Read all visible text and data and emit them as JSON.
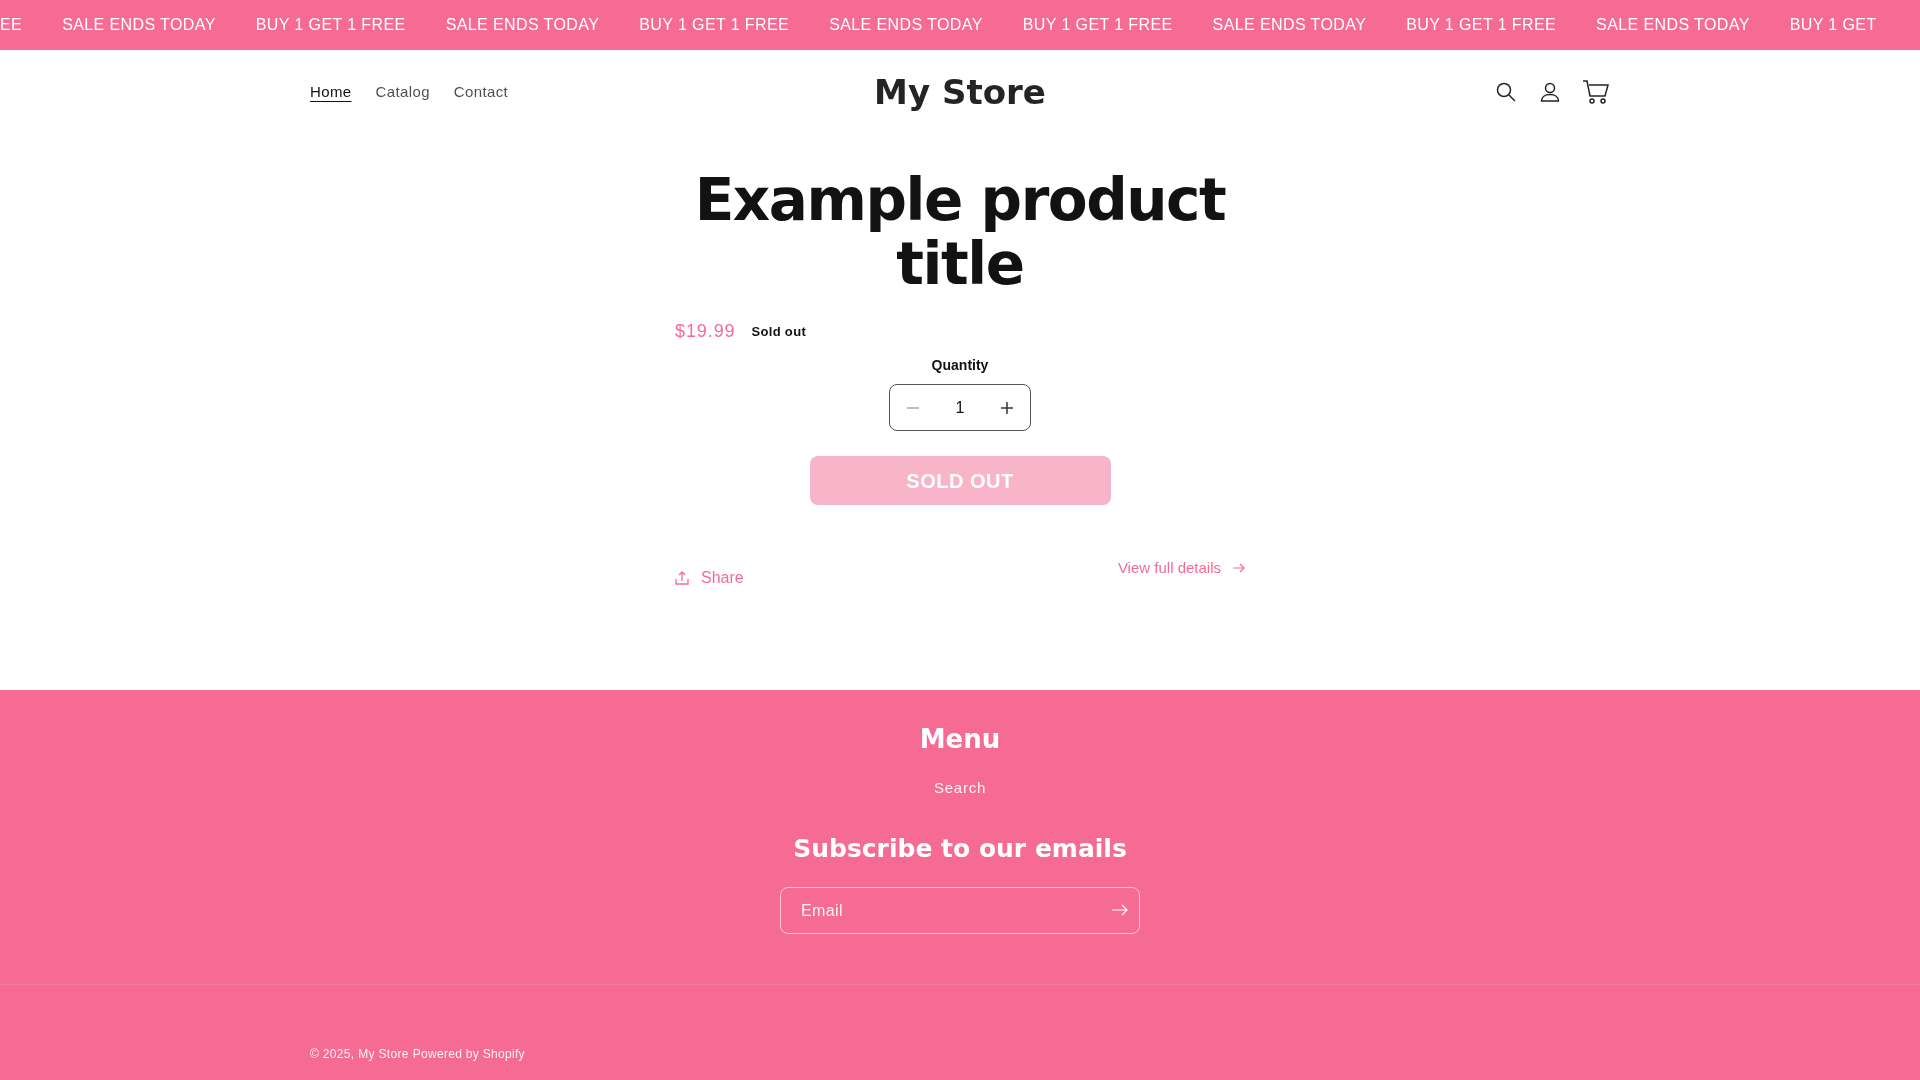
{
  "announcement_bar": {
    "messages": [
      "EE",
      "SALE ENDS TODAY",
      "BUY 1 GET 1 FREE",
      "SALE ENDS TODAY",
      "BUY 1 GET 1 FREE",
      "SALE ENDS TODAY",
      "BUY 1 GET 1 FREE",
      "SALE ENDS TODAY",
      "BUY 1 GET 1 FREE",
      "SALE ENDS TODAY",
      "BUY 1 GET"
    ]
  },
  "header": {
    "nav": [
      {
        "label": "Home",
        "selected": true
      },
      {
        "label": "Catalog",
        "selected": false
      },
      {
        "label": "Contact",
        "selected": false
      }
    ],
    "logo": "My Store"
  },
  "product": {
    "title": "Example product title",
    "price": "$19.99",
    "badge": "Sold out",
    "quantity": {
      "label": "Quantity",
      "value": "1"
    },
    "add_button": {
      "label": "SOLD OUT",
      "disabled": true
    },
    "share": "Share",
    "details_link": "View full details"
  },
  "footer": {
    "menu_heading": "Menu",
    "menu_links": [
      "Search"
    ],
    "newsletter_heading": "Subscribe to our emails",
    "email_placeholder": "Email",
    "copyright": "© 2025,",
    "store_link": "My Store",
    "powered_by": "Powered by Shopify"
  }
}
